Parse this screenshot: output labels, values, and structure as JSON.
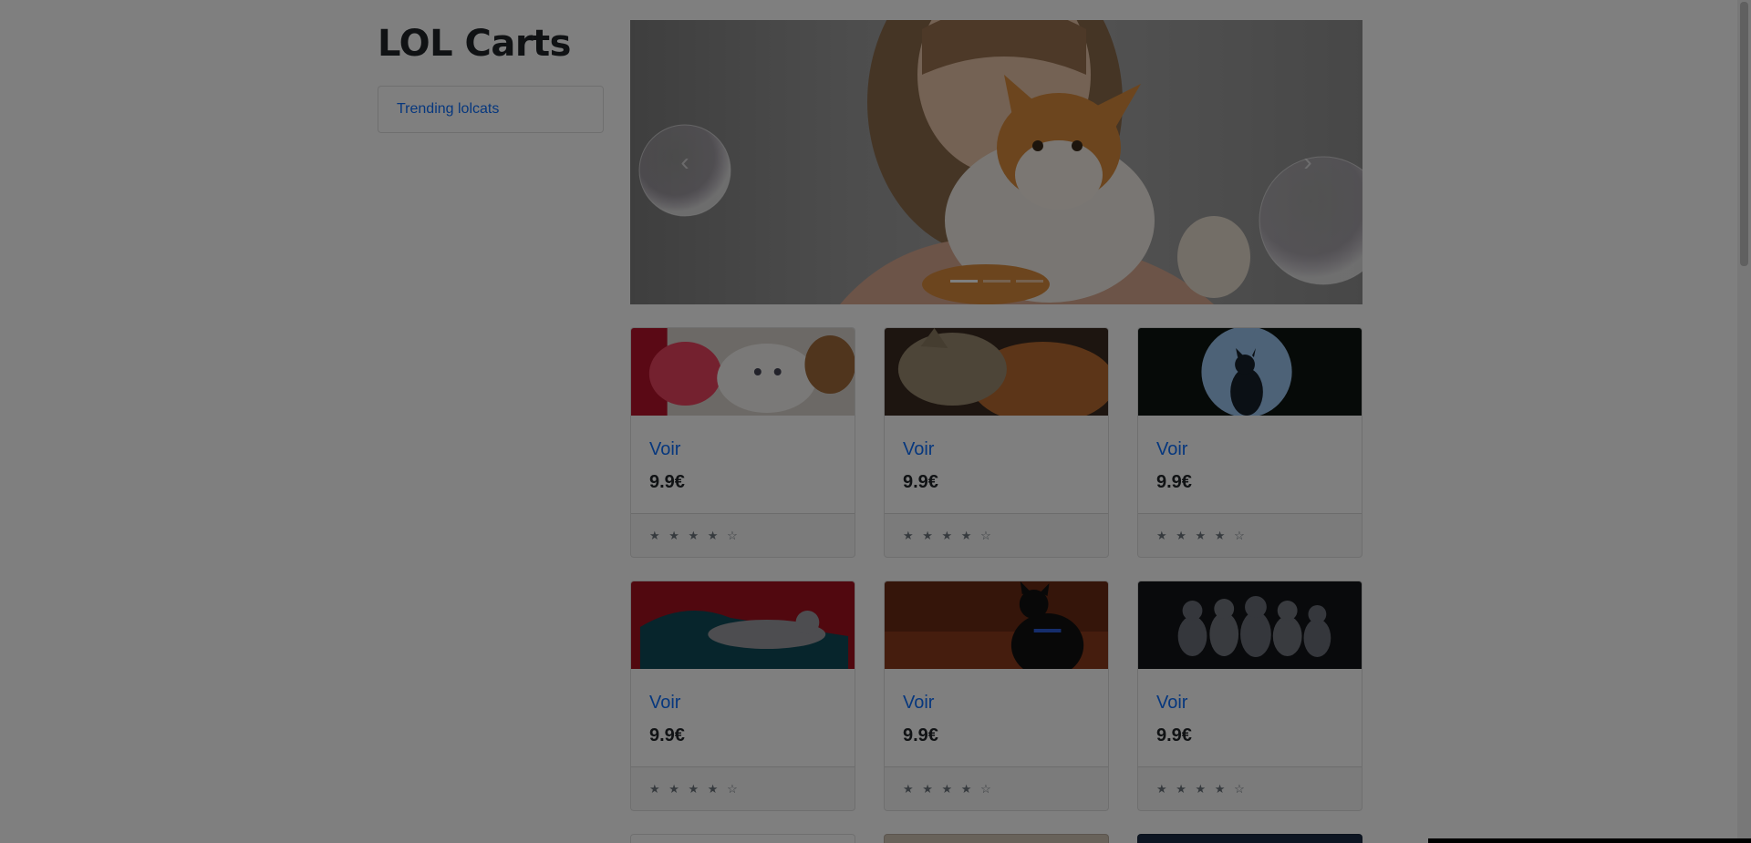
{
  "brand": {
    "title": "LOL Carts"
  },
  "sidebar": {
    "items": [
      {
        "label": "Trending lolcats"
      }
    ]
  },
  "carousel": {
    "prev_icon": "chevron-left-icon",
    "next_icon": "chevron-right-icon",
    "prev_glyph": "‹",
    "next_glyph": "›",
    "slide_count": 3,
    "active_slide": 1,
    "image": "girl-with-orange-kitten-and-bubbles"
  },
  "products": [
    {
      "title": "Voir",
      "price": "9.9€",
      "rating": "★ ★ ★ ★ ☆",
      "image": "white-kitten-with-pink-plush"
    },
    {
      "title": "Voir",
      "price": "9.9€",
      "rating": "★ ★ ★ ★ ☆",
      "image": "tabby-cat-sleeping-on-dog"
    },
    {
      "title": "Voir",
      "price": "9.9€",
      "rating": "★ ★ ★ ★ ☆",
      "image": "cat-silhouette-against-moon"
    },
    {
      "title": "Voir",
      "price": "9.9€",
      "rating": "★ ★ ★ ★ ☆",
      "image": "gray-cat-on-teal-sofa"
    },
    {
      "title": "Voir",
      "price": "9.9€",
      "rating": "★ ★ ★ ★ ☆",
      "image": "black-cat-blue-collar"
    },
    {
      "title": "Voir",
      "price": "9.9€",
      "rating": "★ ★ ★ ★ ☆",
      "image": "five-gray-kittens"
    }
  ],
  "colors": {
    "link": "#0d6efd",
    "overlay": "rgba(0,0,0,0.5)"
  }
}
